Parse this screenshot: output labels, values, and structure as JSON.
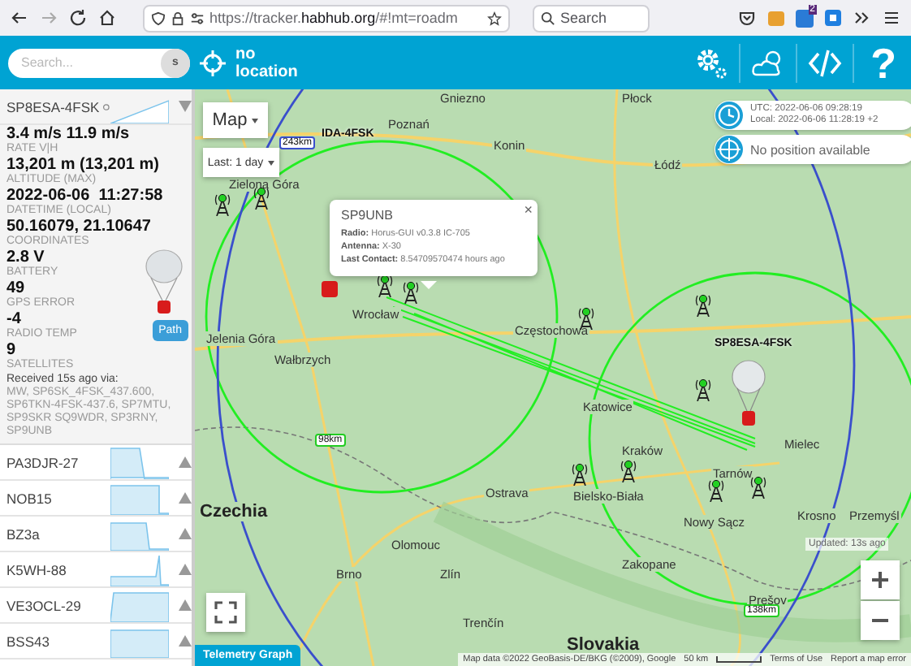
{
  "browser": {
    "url_scheme": "https://tracker.",
    "url_host": "habhub.org",
    "url_path": "/#!mt=roadm",
    "search_placeholder": "Search",
    "extension_badge": "2"
  },
  "header": {
    "search_placeholder": "Search...",
    "search_button": "s",
    "location": "no location",
    "help": "?"
  },
  "vehicles": [
    {
      "name": "SP8ESA-4FSK",
      "expanded": true,
      "fields": [
        {
          "value": "3.4 m/s 11.9 m/s",
          "label": "RATE V|H"
        },
        {
          "value": "13,201 m (13,201 m)",
          "label": "ALTITUDE (MAX)"
        },
        {
          "value": "2022-06-06  11:27:58",
          "label": "DATETIME (LOCAL)"
        },
        {
          "value": "50.16079, 21.10647",
          "label": "COORDINATES"
        },
        {
          "value": "2.8 V",
          "label": "BATTERY"
        },
        {
          "value": "49",
          "label": "GPS ERROR"
        },
        {
          "value": "-4",
          "label": "RADIO TEMP"
        },
        {
          "value": "9",
          "label": "SATELLITES"
        }
      ],
      "received": "Received 15s ago via:",
      "receivers": "MW, SP6SK_4FSK_437.600, SP6TKN-4FSK-437.6, SP7MTU, SP9SKR SQ9WDR, SP3RNY, SP9UNB",
      "path_button": "Path"
    },
    {
      "name": "PA3DJR-27",
      "expanded": false
    },
    {
      "name": "NOB15",
      "expanded": false
    },
    {
      "name": "BZ3a",
      "expanded": false
    },
    {
      "name": "K5WH-88",
      "expanded": false
    },
    {
      "name": "VE3OCL-29",
      "expanded": false
    },
    {
      "name": "BSS43",
      "expanded": false
    }
  ],
  "map": {
    "map_type": "Map",
    "time_filter": "Last: 1 day",
    "labels": [
      {
        "text": "Gniezno",
        "kind": "city"
      },
      {
        "text": "Płock",
        "kind": "city"
      },
      {
        "text": "Poznań",
        "kind": "city"
      },
      {
        "text": "Konin",
        "kind": "city"
      },
      {
        "text": "Łódź",
        "kind": "city"
      },
      {
        "text": "Zielona Góra",
        "kind": "city"
      },
      {
        "text": "Wrocław",
        "kind": "city"
      },
      {
        "text": "Jelenia Góra",
        "kind": "city"
      },
      {
        "text": "Wałbrzych",
        "kind": "city"
      },
      {
        "text": "Częstochowa",
        "kind": "city"
      },
      {
        "text": "Katowice",
        "kind": "city"
      },
      {
        "text": "Kraków",
        "kind": "city"
      },
      {
        "text": "Tarnów",
        "kind": "city"
      },
      {
        "text": "Mielec",
        "kind": "city"
      },
      {
        "text": "Ostrava",
        "kind": "city"
      },
      {
        "text": "Bielsko-Biała",
        "kind": "city"
      },
      {
        "text": "Nowy Sącz",
        "kind": "city"
      },
      {
        "text": "Krosno",
        "kind": "city"
      },
      {
        "text": "Przemyśl",
        "kind": "city"
      },
      {
        "text": "Olomouc",
        "kind": "city"
      },
      {
        "text": "Brno",
        "kind": "city"
      },
      {
        "text": "Zlín",
        "kind": "city"
      },
      {
        "text": "Trenčín",
        "kind": "city"
      },
      {
        "text": "Zakopane",
        "kind": "city"
      },
      {
        "text": "Prešov",
        "kind": "city"
      },
      {
        "text": "Czechia",
        "kind": "country"
      },
      {
        "text": "Slovakia",
        "kind": "country"
      }
    ],
    "callsigns": [
      "IDA-4FSK",
      "SP8ESA-4FSK"
    ],
    "distances": [
      "243km",
      "98km",
      "138km"
    ],
    "popup": {
      "title": "SP9UNB",
      "close": "×",
      "rows": [
        {
          "label": "Radio:",
          "value": "Horus-GUI v0.3.8 IC-705"
        },
        {
          "label": "Antenna:",
          "value": "X-30"
        },
        {
          "label": "Last Contact:",
          "value": "8.54709570474 hours ago"
        }
      ]
    },
    "clock": {
      "utc": "UTC: 2022-06-06 09:28:19",
      "local": "Local: 2022-06-06 11:28:19 +2"
    },
    "position": "No position available",
    "updated": "Updated: 13s ago",
    "attribution": "Map data ©2022 GeoBasis-DE/BKG (©2009), Google",
    "scale": "50 km",
    "terms": "Terms of Use",
    "report": "Report a map error"
  },
  "telemetry_tab": "Telemetry Graph"
}
